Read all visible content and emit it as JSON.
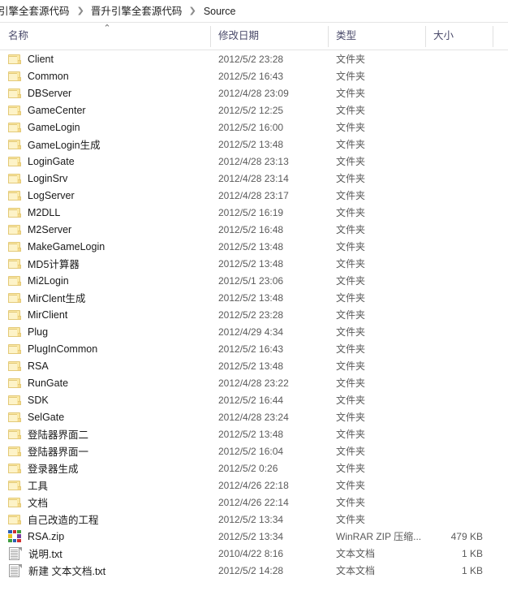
{
  "breadcrumb": {
    "items": [
      {
        "label": "引擎全套源代码"
      },
      {
        "label": "晋升引擎全套源代码"
      },
      {
        "label": "Source"
      }
    ],
    "separator": "❯"
  },
  "columns": {
    "name": "名称",
    "date_modified": "修改日期",
    "type": "类型",
    "size": "大小",
    "sort_indicator": "⌃",
    "sort_column": "名称",
    "sort_direction": "ascending"
  },
  "colors": {
    "folder_body": "#fbe9a6",
    "folder_front": "#fdf3c8",
    "folder_border": "#e3c977",
    "header_text": "#4a4a6a",
    "row_text": "#1a1a1a",
    "meta_text": "#5a5a5a",
    "divider": "#e0e0e0",
    "background": "#ffffff"
  },
  "icons": {
    "folder": "folder-icon",
    "text_document": "text-file-icon",
    "zip_archive": "winrar-zip-icon",
    "sort_asc": "chevron-up-icon",
    "breadcrumb_sep": "chevron-right-icon"
  },
  "zip_icon_colors": [
    "#2b5fb5",
    "#d22f2f",
    "#3f9e3f",
    "#e8c020",
    "#ffffff",
    "#7a3fa0",
    "#3f9e3f",
    "#2b5fb5",
    "#d22f2f"
  ],
  "files": [
    {
      "icon": "folder",
      "name": "Client",
      "date": "2012/5/2 23:28",
      "type": "文件夹",
      "size": ""
    },
    {
      "icon": "folder",
      "name": "Common",
      "date": "2012/5/2 16:43",
      "type": "文件夹",
      "size": ""
    },
    {
      "icon": "folder",
      "name": "DBServer",
      "date": "2012/4/28 23:09",
      "type": "文件夹",
      "size": ""
    },
    {
      "icon": "folder",
      "name": "GameCenter",
      "date": "2012/5/2 12:25",
      "type": "文件夹",
      "size": ""
    },
    {
      "icon": "folder",
      "name": "GameLogin",
      "date": "2012/5/2 16:00",
      "type": "文件夹",
      "size": ""
    },
    {
      "icon": "folder",
      "name": "GameLogin生成",
      "date": "2012/5/2 13:48",
      "type": "文件夹",
      "size": ""
    },
    {
      "icon": "folder",
      "name": "LoginGate",
      "date": "2012/4/28 23:13",
      "type": "文件夹",
      "size": ""
    },
    {
      "icon": "folder",
      "name": "LoginSrv",
      "date": "2012/4/28 23:14",
      "type": "文件夹",
      "size": ""
    },
    {
      "icon": "folder",
      "name": "LogServer",
      "date": "2012/4/28 23:17",
      "type": "文件夹",
      "size": ""
    },
    {
      "icon": "folder",
      "name": "M2DLL",
      "date": "2012/5/2 16:19",
      "type": "文件夹",
      "size": ""
    },
    {
      "icon": "folder",
      "name": "M2Server",
      "date": "2012/5/2 16:48",
      "type": "文件夹",
      "size": ""
    },
    {
      "icon": "folder",
      "name": "MakeGameLogin",
      "date": "2012/5/2 13:48",
      "type": "文件夹",
      "size": ""
    },
    {
      "icon": "folder",
      "name": "MD5计算器",
      "date": "2012/5/2 13:48",
      "type": "文件夹",
      "size": ""
    },
    {
      "icon": "folder",
      "name": "Mi2Login",
      "date": "2012/5/1 23:06",
      "type": "文件夹",
      "size": ""
    },
    {
      "icon": "folder",
      "name": "MirClent生成",
      "date": "2012/5/2 13:48",
      "type": "文件夹",
      "size": ""
    },
    {
      "icon": "folder",
      "name": "MirClient",
      "date": "2012/5/2 23:28",
      "type": "文件夹",
      "size": ""
    },
    {
      "icon": "folder",
      "name": "Plug",
      "date": "2012/4/29 4:34",
      "type": "文件夹",
      "size": ""
    },
    {
      "icon": "folder",
      "name": "PlugInCommon",
      "date": "2012/5/2 16:43",
      "type": "文件夹",
      "size": ""
    },
    {
      "icon": "folder",
      "name": "RSA",
      "date": "2012/5/2 13:48",
      "type": "文件夹",
      "size": ""
    },
    {
      "icon": "folder",
      "name": "RunGate",
      "date": "2012/4/28 23:22",
      "type": "文件夹",
      "size": ""
    },
    {
      "icon": "folder",
      "name": "SDK",
      "date": "2012/5/2 16:44",
      "type": "文件夹",
      "size": ""
    },
    {
      "icon": "folder",
      "name": "SelGate",
      "date": "2012/4/28 23:24",
      "type": "文件夹",
      "size": ""
    },
    {
      "icon": "folder",
      "name": "登陆器界面二",
      "date": "2012/5/2 13:48",
      "type": "文件夹",
      "size": ""
    },
    {
      "icon": "folder",
      "name": "登陆器界面一",
      "date": "2012/5/2 16:04",
      "type": "文件夹",
      "size": ""
    },
    {
      "icon": "folder",
      "name": "登录器生成",
      "date": "2012/5/2 0:26",
      "type": "文件夹",
      "size": ""
    },
    {
      "icon": "folder",
      "name": "工具",
      "date": "2012/4/26 22:18",
      "type": "文件夹",
      "size": ""
    },
    {
      "icon": "folder",
      "name": "文档",
      "date": "2012/4/26 22:14",
      "type": "文件夹",
      "size": ""
    },
    {
      "icon": "folder",
      "name": "自己改造的工程",
      "date": "2012/5/2 13:34",
      "type": "文件夹",
      "size": ""
    },
    {
      "icon": "zip",
      "name": "RSA.zip",
      "date": "2012/5/2 13:34",
      "type": "WinRAR ZIP 压缩...",
      "size": "479 KB"
    },
    {
      "icon": "txt",
      "name": "说明.txt",
      "date": "2010/4/22 8:16",
      "type": "文本文档",
      "size": "1 KB"
    },
    {
      "icon": "txt",
      "name": "新建 文本文档.txt",
      "date": "2012/5/2 14:28",
      "type": "文本文档",
      "size": "1 KB"
    }
  ]
}
